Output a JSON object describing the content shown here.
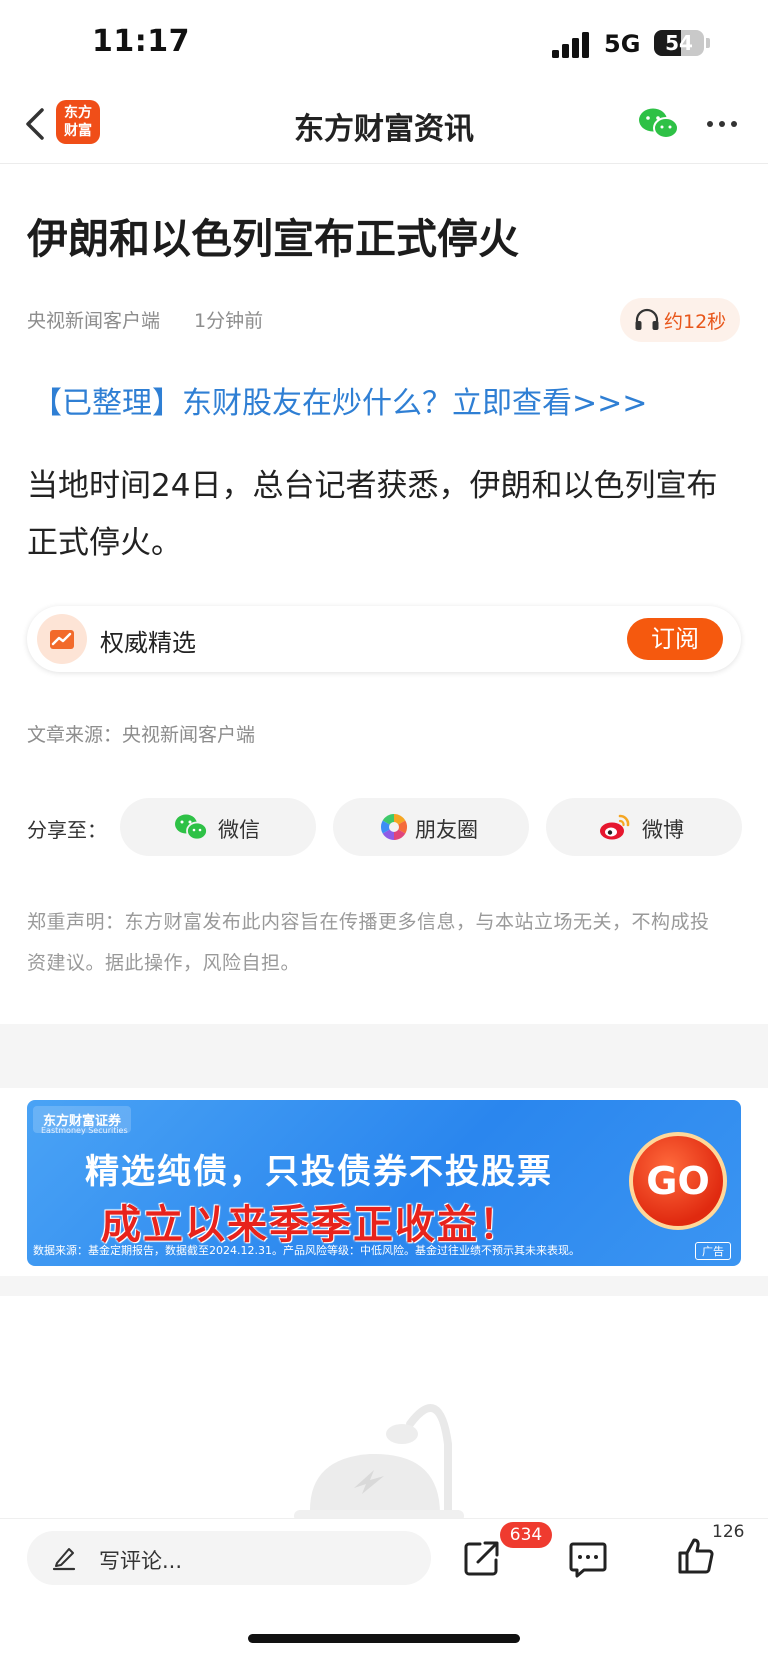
{
  "status_bar": {
    "time": "11:17",
    "network": "5G",
    "battery": "54",
    "battery_level": 0.54
  },
  "nav": {
    "logo_text_line1": "东方",
    "logo_text_line2": "财富",
    "title": "东方财富资讯"
  },
  "article": {
    "headline": "伊朗和以色列宣布正式停火",
    "source": "央视新闻客户端",
    "time_ago": "1分钟前",
    "listen_label": "约12秒",
    "promo_link": "【已整理】东财股友在炒什么？立即查看>>>",
    "body": "当地时间24日，总台记者获悉，伊朗和以色列宣布正式停火。",
    "source_line": "文章来源：央视新闻客户端"
  },
  "subscription": {
    "label": "权威精选",
    "button": "订阅"
  },
  "share": {
    "label": "分享至：",
    "options": [
      {
        "label": "微信",
        "icon": "wechat-icon"
      },
      {
        "label": "朋友圈",
        "icon": "moments-icon"
      },
      {
        "label": "微博",
        "icon": "weibo-icon"
      }
    ]
  },
  "disclaimer": "郑重声明：东方财富发布此内容旨在传播更多信息，与本站立场无关，不构成投资建议。据此操作，风险自担。",
  "ad": {
    "brand": "东方财富证券",
    "brand_en": "Eastmoney Securities",
    "line1": "精选纯债，只投债券不投股票",
    "line2": "成立以来季季正收益！",
    "go": "GO",
    "footnote": "数据来源：基金定期报告，数据截至2024.12.31。产品风险等级：中低风险。基金过往业绩不预示其未来表现。",
    "tag": "广告"
  },
  "bottom_bar": {
    "comment_placeholder": "写评论...",
    "share_count": "634",
    "like_count": "126"
  },
  "colors": {
    "accent": "#f5590e",
    "link": "#2f7fd4",
    "badge": "#ef3b2f"
  }
}
